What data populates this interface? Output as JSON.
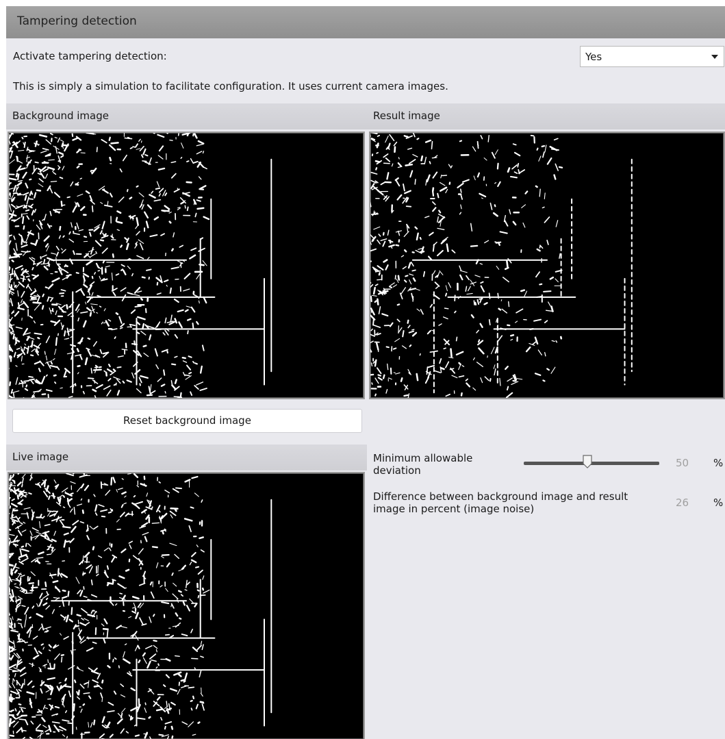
{
  "title": "Tampering detection",
  "activate": {
    "label": "Activate tampering detection:",
    "value": "Yes"
  },
  "info_text": "This is simply a simulation to facilitate configuration. It uses current camera images.",
  "sections": {
    "background": "Background image",
    "result": "Result image",
    "live": "Live image"
  },
  "reset_button": "Reset background image",
  "min_deviation": {
    "label": "Minimum allowable deviation",
    "value": "50",
    "unit": "%",
    "fraction": 0.5
  },
  "difference": {
    "label": "Difference between background image and result image in percent (image noise)",
    "value": "26",
    "unit": "%"
  },
  "icons": {
    "dropdown": "chevron-down-icon",
    "slider": "slider-thumb-icon"
  }
}
